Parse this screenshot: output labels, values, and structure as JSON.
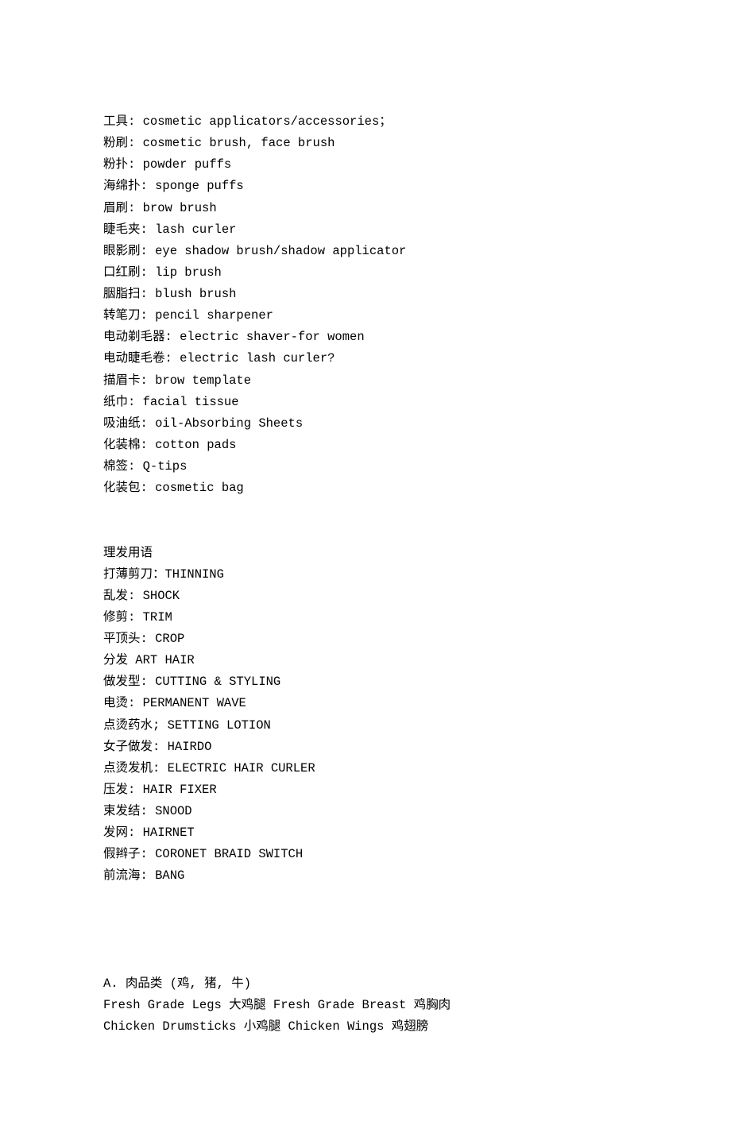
{
  "section1": [
    "工具: cosmetic applicators/accessories；",
    "粉刷: cosmetic brush, face brush",
    "粉扑: powder puffs",
    "海绵扑: sponge puffs",
    "眉刷: brow brush",
    "睫毛夹: lash curler",
    "眼影刷: eye shadow brush/shadow applicator",
    "口红刷: lip brush",
    "胭脂扫: blush brush",
    "转笔刀: pencil sharpener",
    "电动剃毛器: electric shaver-for women",
    "电动睫毛卷: electric lash curler?",
    "描眉卡: brow template",
    "纸巾: facial tissue",
    "吸油纸: oil-Absorbing Sheets",
    "化装棉: cotton pads",
    "棉签: Q-tips",
    "化装包: cosmetic bag"
  ],
  "section2": [
    "理发用语",
    "打薄剪刀：THINNING",
    "乱发: SHOCK",
    "修剪: TRIM",
    "平顶头: CROP",
    "分发 ART HAIR",
    "做发型: CUTTING & STYLING",
    "电烫: PERMANENT WAVE",
    "点烫药水; SETTING LOTION",
    "女子做发: HAIRDO",
    "点烫发机: ELECTRIC HAIR CURLER",
    "压发: HAIR FIXER",
    "束发结: SNOOD",
    "发网: HAIRNET",
    "假辫子: CORONET BRAID SWITCH",
    "前流海: BANG"
  ],
  "section3": [
    "A. 肉品类 (鸡, 猪, 牛)",
    "Fresh Grade Legs 大鸡腿 Fresh Grade Breast 鸡胸肉",
    "Chicken Drumsticks 小鸡腿 Chicken Wings 鸡翅膀"
  ]
}
